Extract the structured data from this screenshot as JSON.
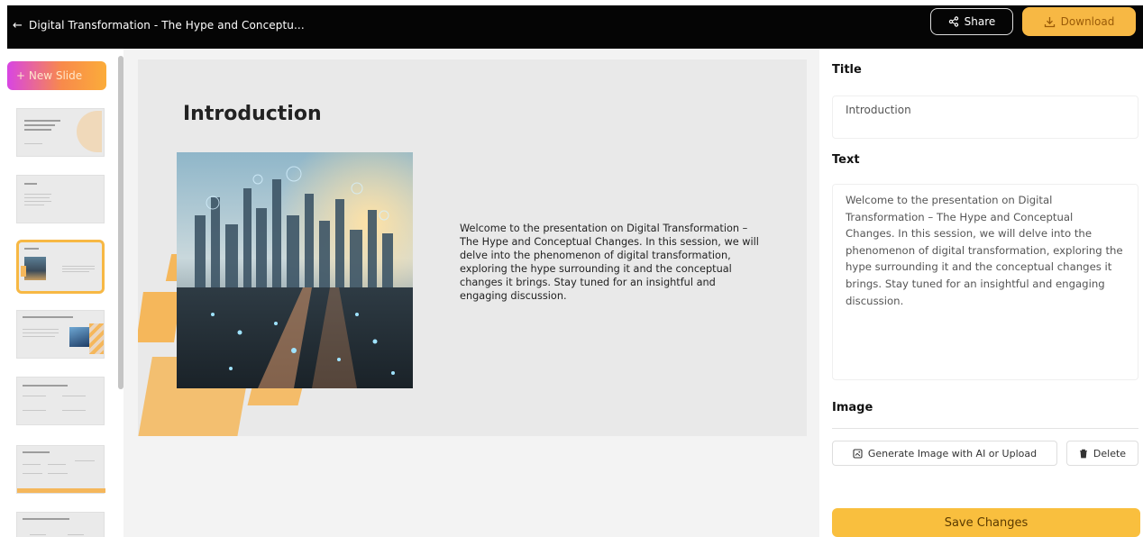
{
  "header": {
    "back_icon": "arrow-left-icon",
    "title": "Digital Transformation - The Hype and Conceptu...",
    "share_label": "Share",
    "share_icon": "share-icon",
    "download_label": "Download",
    "download_icon": "download-icon"
  },
  "sidebar": {
    "new_slide_label": "+ New Slide",
    "active_index": 2
  },
  "slide": {
    "title": "Introduction",
    "body": "Welcome to the presentation on Digital Transformation – The Hype and Conceptual Changes. In this session, we will delve into the phenomenon of digital transformation, exploring the hype surrounding it and the conceptual changes it brings. Stay tuned for an insightful and engaging discussion.",
    "accent_color": "#f5b75b"
  },
  "editor": {
    "title_label": "Title",
    "title_value": "Introduction",
    "text_label": "Text",
    "text_value": "Welcome to the presentation on Digital Transformation – The Hype and Conceptual Changes. In this session, we will delve into the phenomenon of digital transformation, exploring the hype surrounding it and the conceptual changes it brings. Stay tuned for an insightful and engaging discussion.",
    "image_label": "Image",
    "generate_label": "Generate Image with AI or Upload",
    "generate_icon": "image-ai-icon",
    "delete_label": "Delete",
    "delete_icon": "trash-icon",
    "save_label": "Save Changes"
  },
  "colors": {
    "accent": "#f7b844",
    "topbar": "#050505"
  }
}
